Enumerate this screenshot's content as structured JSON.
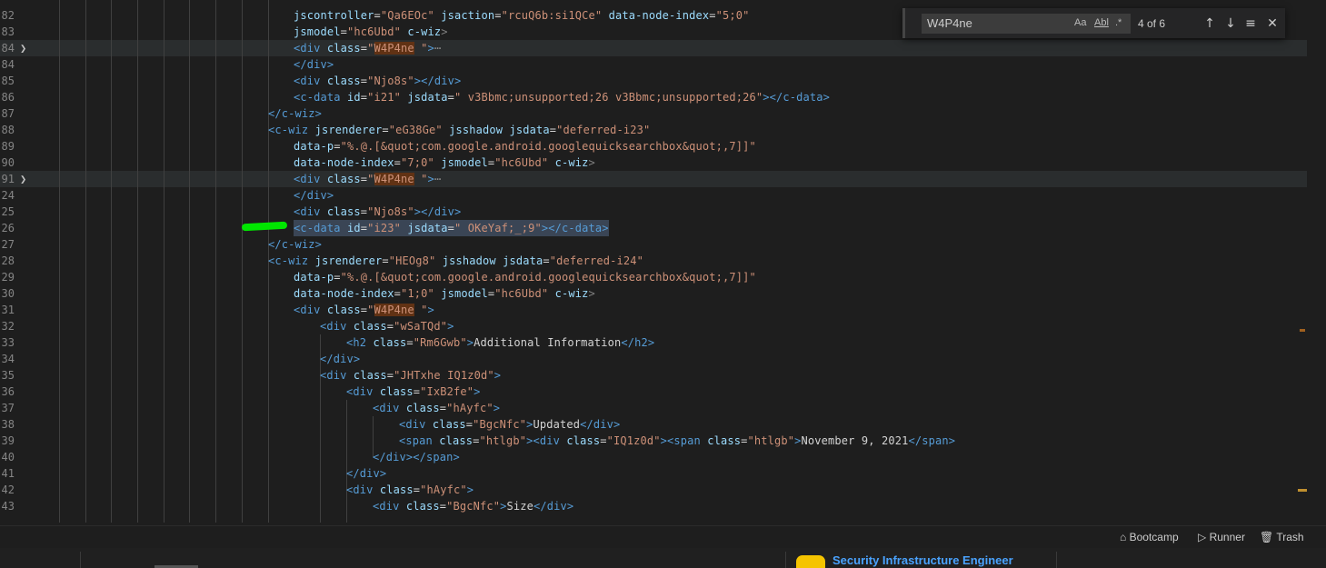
{
  "find_widget": {
    "query": "W4P4ne",
    "match_case_label": "Aa",
    "whole_word_label": "Abl",
    "regex_label": ".*",
    "count": "4 of 6",
    "prev_glyph": "↑",
    "next_glyph": "↓",
    "selection_glyph": "≡",
    "close_glyph": "✕"
  },
  "lines": {
    "l0": {
      "num": "82",
      "a1": "jscontroller",
      "s1": "\"Qa6EOc\"",
      "a2": "jsaction",
      "s2": "\"rcuQ6b:si1QCe\"",
      "a3": "data-node-index",
      "s3": "\"5;0\""
    },
    "l1": {
      "num": "83",
      "a1": "jsmodel",
      "s1": "\"hc6Ubd\"",
      "a2": "c-wiz",
      "gt": ">"
    },
    "l2": {
      "num": "84",
      "tag": "<div",
      "a1": "class",
      "eq": "=",
      "q1": "\"",
      "mark": "W4P4ne",
      "q2": " \"",
      "gt": ">",
      "ell": "⋯"
    },
    "l3": {
      "num": "84",
      "tag": "</div>"
    },
    "l4": {
      "num": "85",
      "tag": "<div",
      "a1": "class",
      "s1": "\"Njo8s\"",
      "close": "></div>"
    },
    "l5": {
      "num": "86",
      "tag": "<c-data",
      "a1": "id",
      "s1": "\"i21\"",
      "a2": "jsdata",
      "s2": "\" v3Bbmc;unsupported;26 v3Bbmc;unsupported;26\"",
      "close": "></c-data>"
    },
    "l6": {
      "num": "87",
      "tag": "</c-wiz>"
    },
    "l7": {
      "num": "88",
      "tag": "<c-wiz",
      "a1": "jsrenderer",
      "s1": "\"eG38Ge\"",
      "a2": "jsshadow",
      "a3": "jsdata",
      "s3": "\"deferred-i23\""
    },
    "l8": {
      "num": "89",
      "a1": "data-p",
      "s1": "\"%.@.[&quot;com.google.android.googlequicksearchbox&quot;,7]]\""
    },
    "l9": {
      "num": "90",
      "a1": "data-node-index",
      "s1": "\"7;0\"",
      "a2": "jsmodel",
      "s2": "\"hc6Ubd\"",
      "a3": "c-wiz",
      "gt": ">"
    },
    "l10": {
      "num": "91",
      "tag": "<div",
      "a1": "class",
      "eq": "=",
      "q1": "\"",
      "mark": "W4P4ne",
      "q2": " \"",
      "gt": ">",
      "ell": "⋯"
    },
    "l11": {
      "num": "24",
      "tag": "</div>"
    },
    "l12": {
      "num": "25",
      "tag": "<div",
      "a1": "class",
      "s1": "\"Njo8s\"",
      "close": "></div>"
    },
    "l13": {
      "num": "26",
      "tag": "<c-data",
      "a1": "id",
      "s1": "\"i23\"",
      "a2": "jsdata",
      "s2": "\" OKeYaf;_;9\"",
      "close": "></c-data>"
    },
    "l14": {
      "num": "27",
      "tag": "</c-wiz>"
    },
    "l15": {
      "num": "28",
      "tag": "<c-wiz",
      "a1": "jsrenderer",
      "s1": "\"HEOg8\"",
      "a2": "jsshadow",
      "a3": "jsdata",
      "s3": "\"deferred-i24\""
    },
    "l16": {
      "num": "29",
      "a1": "data-p",
      "s1": "\"%.@.[&quot;com.google.android.googlequicksearchbox&quot;,7]]\""
    },
    "l17": {
      "num": "30",
      "a1": "data-node-index",
      "s1": "\"1;0\"",
      "a2": "jsmodel",
      "s2": "\"hc6Ubd\"",
      "a3": "c-wiz",
      "gt": ">"
    },
    "l18": {
      "num": "31",
      "tag": "<div",
      "a1": "class",
      "eq": "=",
      "q1": "\"",
      "mark": "W4P4ne",
      "q2": " \"",
      "gt": ">"
    },
    "l19": {
      "num": "32",
      "tag": "<div",
      "a1": "class",
      "s1": "\"wSaTQd\"",
      "gt": ">"
    },
    "l20": {
      "num": "33",
      "tag": "<h2",
      "a1": "class",
      "s1": "\"Rm6Gwb\"",
      "gt": ">",
      "text": "Additional Information",
      "close": "</h2>"
    },
    "l21": {
      "num": "34",
      "tag": "</div>"
    },
    "l22": {
      "num": "35",
      "tag": "<div",
      "a1": "class",
      "s1": "\"JHTxhe IQ1z0d\"",
      "gt": ">"
    },
    "l23": {
      "num": "36",
      "tag": "<div",
      "a1": "class",
      "s1": "\"IxB2fe\"",
      "gt": ">"
    },
    "l24": {
      "num": "37",
      "tag": "<div",
      "a1": "class",
      "s1": "\"hAyfc\"",
      "gt": ">"
    },
    "l25": {
      "num": "38",
      "tag": "<div",
      "a1": "class",
      "s1": "\"BgcNfc\"",
      "gt": ">",
      "text": "Updated",
      "close": "</div>"
    },
    "l26": {
      "num": "39",
      "tag": "<span",
      "a1": "class",
      "s1": "\"htlgb\"",
      "t2": "><div",
      "a2": "class",
      "s2": "\"IQ1z0d\"",
      "t3": "><span",
      "a3": "class",
      "s3": "\"htlgb\"",
      "gt": ">",
      "text": "November 9, 2021",
      "close": "</span>"
    },
    "l27": {
      "num": "40",
      "tag": "</div></span>"
    },
    "l28": {
      "num": "41",
      "tag": "</div>"
    },
    "l29": {
      "num": "42",
      "tag": "<div",
      "a1": "class",
      "s1": "\"hAyfc\"",
      "gt": ">"
    },
    "l30": {
      "num": "43",
      "tag": "<div",
      "a1": "class",
      "s1": "\"BgcNfc\"",
      "gt": ">",
      "text": "Size",
      "close": "</div>"
    }
  },
  "status_bar": {
    "bootcamp": "Bootcamp",
    "runner": "Runner",
    "trash": "Trash"
  },
  "taskbar": {
    "window_title": "Security Infrastructure Engineer"
  },
  "colors": {
    "background": "#1e1e1e",
    "match_highlight": "#613214",
    "tag": "#569cd6",
    "attribute": "#9cdcfe",
    "string": "#ce9178",
    "annotation": "#00e600"
  }
}
